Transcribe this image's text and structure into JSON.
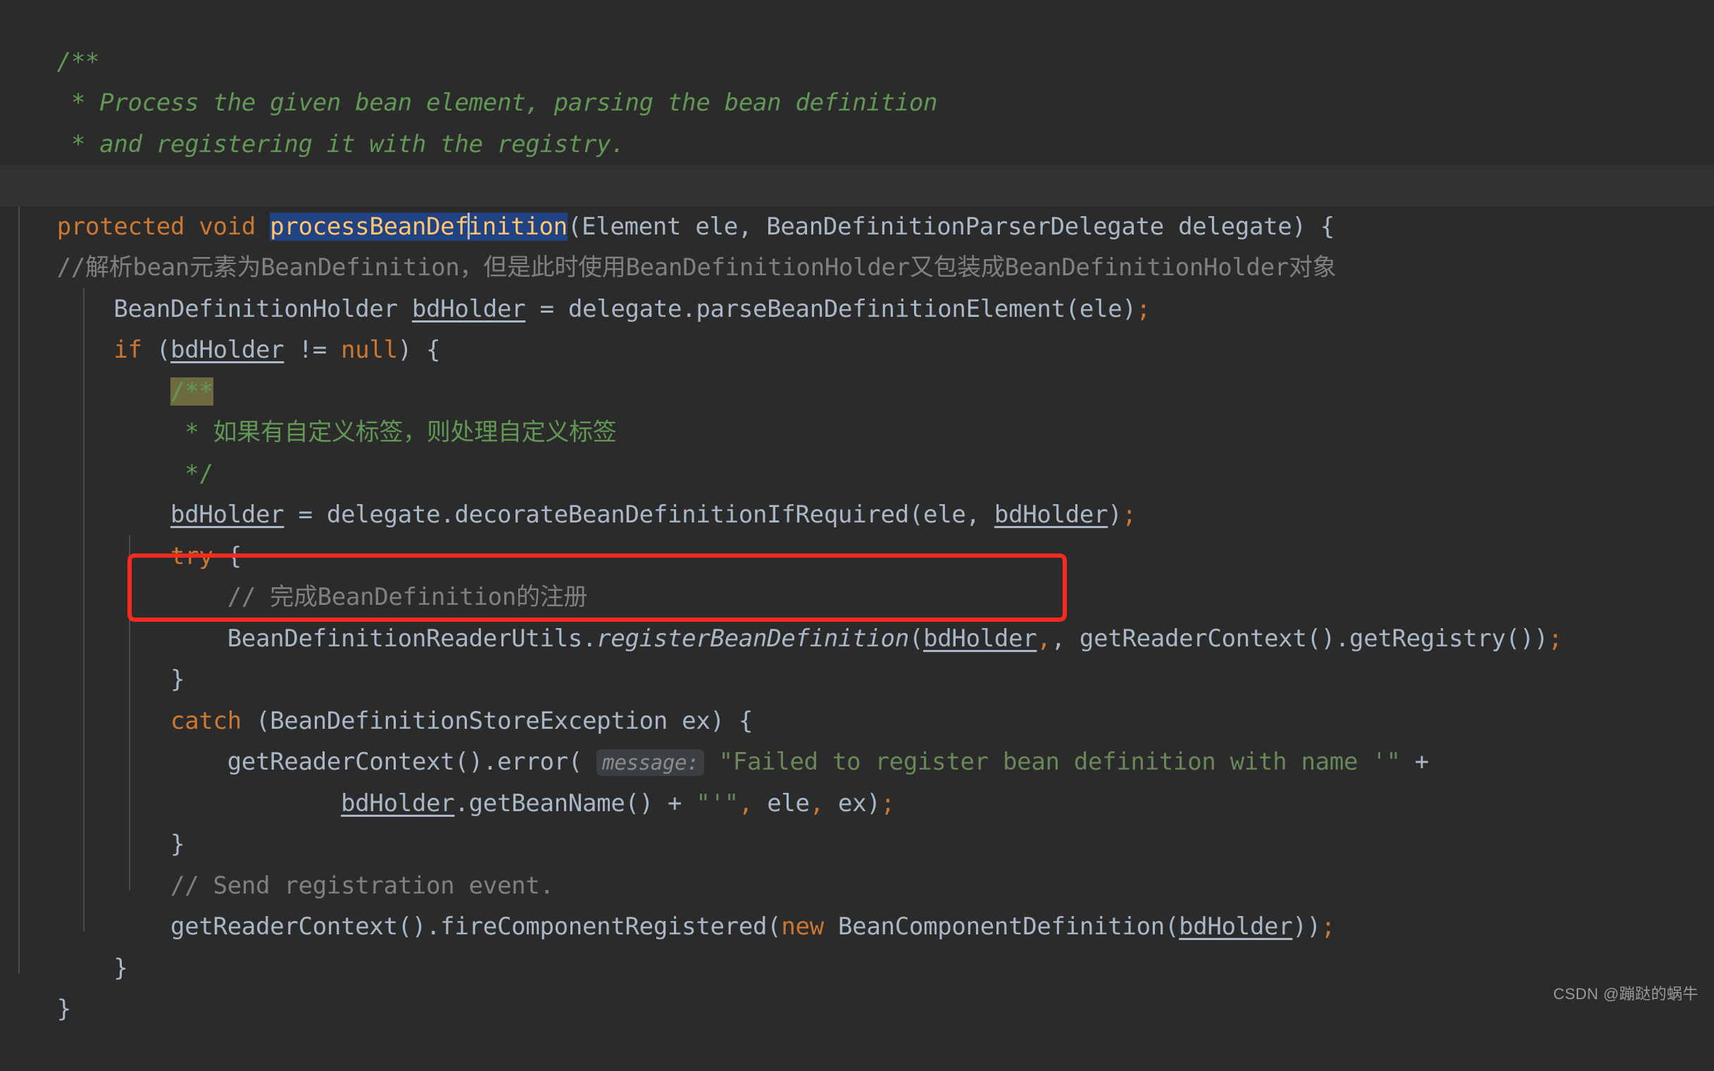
{
  "editor": {
    "theme": "darcula",
    "background": "#2b2b2b",
    "current_line_background": "#323232",
    "colors": {
      "keyword": "#cc7832",
      "identifier": "#a9b7c6",
      "method": "#ffc66d",
      "string": "#6a8759",
      "line_comment": "#808080",
      "doc_comment": "#629755",
      "selection": "#214283",
      "search_highlight": "#6f6b41",
      "inlay_hint_bg": "#3c3f41",
      "inlay_hint_text": "#8c8c8c",
      "annotation_box": "#f92b21",
      "indent_guide": "#4b4b4b"
    },
    "selected_text": "processBeanDefinition",
    "inlay_hint": "message:",
    "annotation_box_label": "red-highlight-rectangle"
  },
  "code": {
    "lines": [
      {
        "id": "l1",
        "text": "/**"
      },
      {
        "id": "l2",
        "text": " * Process the given bean element, parsing the bean definition"
      },
      {
        "id": "l3",
        "text": " * and registering it with the registry."
      },
      {
        "id": "l4",
        "text": " */"
      },
      {
        "id": "l5",
        "text": "protected void processBeanDefinition(Element ele, BeanDefinitionParserDelegate delegate) {"
      },
      {
        "id": "l6",
        "text": "    //解析bean元素为BeanDefinition，但是此时使用BeanDefinitionHolder又包装成BeanDefinitionHolder对象"
      },
      {
        "id": "l7",
        "text": "    BeanDefinitionHolder bdHolder = delegate.parseBeanDefinitionElement(ele);"
      },
      {
        "id": "l8",
        "text": "    if (bdHolder != null) {"
      },
      {
        "id": "l9",
        "text": "        /**"
      },
      {
        "id": "l10",
        "text": "         * 如果有自定义标签，则处理自定义标签"
      },
      {
        "id": "l11",
        "text": "         */"
      },
      {
        "id": "l12",
        "text": "        bdHolder = delegate.decorateBeanDefinitionIfRequired(ele, bdHolder);"
      },
      {
        "id": "l13",
        "text": "        try {"
      },
      {
        "id": "l14",
        "text": "            // 完成BeanDefinition的注册"
      },
      {
        "id": "l15",
        "text": "            BeanDefinitionReaderUtils.registerBeanDefinition(bdHolder, getReaderContext().getRegistry());"
      },
      {
        "id": "l16",
        "text": "        }"
      },
      {
        "id": "l17",
        "text": "        catch (BeanDefinitionStoreException ex) {"
      },
      {
        "id": "l18",
        "text": "            getReaderContext().error( message: \"Failed to register bean definition with name '\" +"
      },
      {
        "id": "l19",
        "text": "                    bdHolder.getBeanName() + \"'\", ele, ex);"
      },
      {
        "id": "l20",
        "text": "        }"
      },
      {
        "id": "l21",
        "text": "        // Send registration event."
      },
      {
        "id": "l22",
        "text": "        getReaderContext().fireComponentRegistered(new BeanComponentDefinition(bdHolder));"
      },
      {
        "id": "l23",
        "text": "    }"
      },
      {
        "id": "l24",
        "text": "}"
      }
    ],
    "tokens": {
      "doc_open": "/**",
      "doc_line_1": " * Process the given bean element, parsing the bean definition",
      "doc_line_2": " * and registering it with the registry.",
      "doc_close": " */",
      "kw_protected": "protected",
      "kw_void": "void",
      "method_name": "processBeanDefinition",
      "sig_rest": "(Element ele, BeanDefinitionParserDelegate delegate) {",
      "comment_cn_1": "//解析bean元素为BeanDefinition，但是此时使用BeanDefinitionHolder又包装成BeanDefinitionHolder对象",
      "decl_type": "BeanDefinitionHolder ",
      "var_bdHolder": "bdHolder",
      "decl_rest": " = delegate.parseBeanDefinitionElement(ele)",
      "semicolon": ";",
      "kw_if": "if",
      "if_open": " (",
      "if_neq": " != ",
      "kw_null": "null",
      "if_close": ") {",
      "inner_doc_open": "/**",
      "inner_doc_cn": "         * 如果有自定义标签，则处理自定义标签",
      "inner_doc_close": "         */",
      "assign_rest": " = delegate.decorateBeanDefinitionIfRequired(ele, ",
      "assign_tail": ")",
      "kw_try": "try",
      "try_brace": " {",
      "comment_cn_2": "// 完成BeanDefinition的注册",
      "reader_utils": "BeanDefinitionReaderUtils.",
      "register_method": "registerBeanDefinition",
      "register_args_mid": ", getReaderContext().getRegistry())",
      "brace_close": "}",
      "kw_catch": "catch",
      "catch_rest": " (BeanDefinitionStoreException ex) {",
      "error_call": "getReaderContext().error( ",
      "hint_message": "message:",
      "error_string": "\"Failed to register bean definition with name '\"",
      "plus": " +",
      "get_bean_name": ".getBeanName() ",
      "plus2": "+ ",
      "quote_str": "\"'\"",
      "comma": ",",
      "arg_ele": " ele",
      "arg_ex": " ex)",
      "comment_en": "// Send registration event.",
      "fire_call": "getReaderContext().fireComponentRegistered(",
      "kw_new": "new",
      "component_def": " BeanComponentDefinition(",
      "fire_tail": "))"
    }
  },
  "watermark": {
    "text": "CSDN @蹦跶的蜗牛"
  }
}
